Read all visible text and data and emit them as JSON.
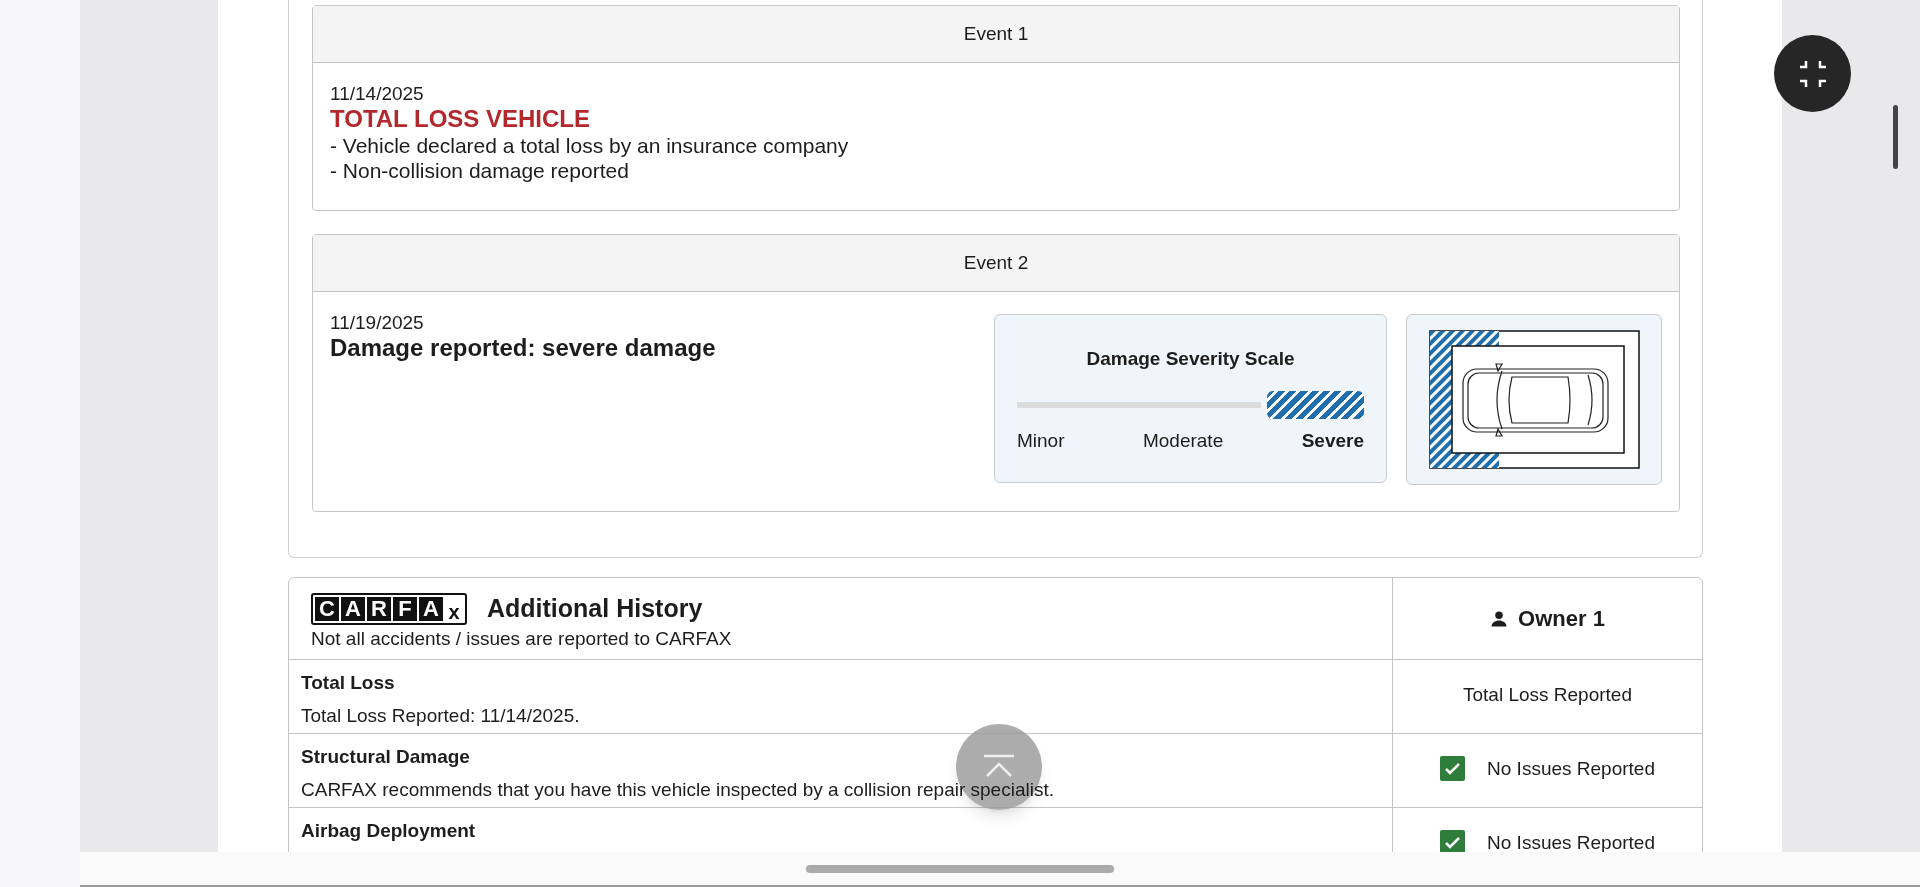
{
  "events": [
    {
      "header": "Event 1",
      "date": "11/14/2025",
      "title": "TOTAL LOSS VEHICLE",
      "kind": "alert",
      "lines": [
        "- Vehicle declared a total loss by an insurance company",
        "- Non-collision damage reported"
      ]
    },
    {
      "header": "Event 2",
      "date": "11/19/2025",
      "title": "Damage reported: severe damage",
      "kind": "damage",
      "severity": {
        "title": "Damage Severity Scale",
        "levels": [
          {
            "label": "Minor",
            "selected": false
          },
          {
            "label": "Moderate",
            "selected": false
          },
          {
            "label": "Severe",
            "selected": true
          }
        ]
      }
    }
  ],
  "additional_history": {
    "logo_letters": [
      "C",
      "A",
      "R",
      "F",
      "A",
      "x"
    ],
    "title": "Additional History",
    "subtitle": "Not all accidents / issues are reported to CARFAX",
    "owner": "Owner 1",
    "rows": [
      {
        "title": "Total Loss",
        "description": "Total Loss Reported: 11/14/2025.",
        "status": "Total Loss Reported",
        "checked": false
      },
      {
        "title": "Structural Damage",
        "description": "CARFAX recommends that you have this vehicle inspected by a collision repair specialist.",
        "status": "No Issues Reported",
        "checked": true
      },
      {
        "title": "Airbag Deployment",
        "status": "No Issues Reported",
        "checked": true
      }
    ]
  }
}
